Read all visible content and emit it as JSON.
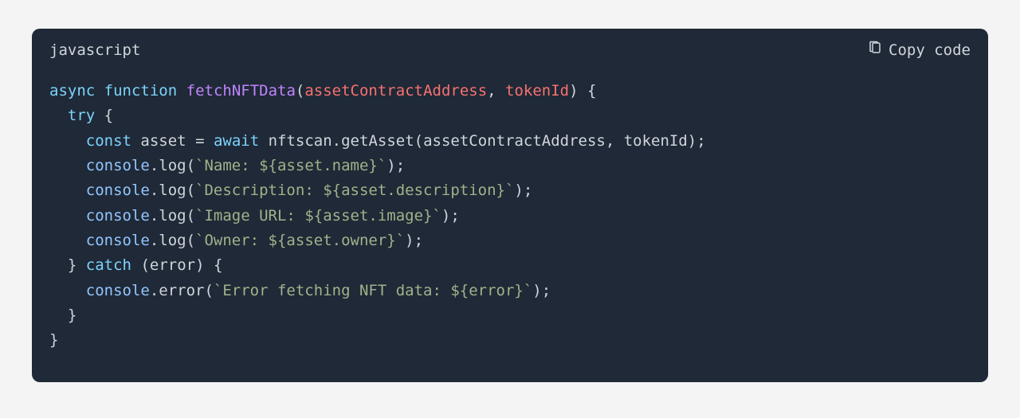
{
  "header": {
    "language": "javascript",
    "copy_label": "Copy code"
  },
  "code": {
    "kw_async": "async",
    "kw_function": "function",
    "fn_name": "fetchNFTData",
    "param1": "assetContractAddress",
    "param2": "tokenId",
    "kw_try": "try",
    "kw_const": "const",
    "var_asset": "asset",
    "kw_await": "await",
    "call_getAsset": "nftscan.getAsset(assetContractAddress, tokenId);",
    "console": "console",
    "log": ".log(",
    "str_name": "`Name: ${asset.name}`",
    "str_desc": "`Description: ${asset.description}`",
    "str_img": "`Image URL: ${asset.image}`",
    "str_owner": "`Owner: ${asset.owner}`",
    "close_call": ");",
    "kw_catch": "catch",
    "err_param": "(error) {",
    "error_method": ".error(",
    "str_err": "`Error fetching NFT data: ${error}`",
    "brace_open_fn": ") {",
    "brace_open": "{",
    "brace_close": "}",
    "comma_sep": ", ",
    "eq": " = ",
    "lparen": "(",
    "rparen": ")",
    "i1": "  ",
    "i2": "    ",
    "sp": " "
  }
}
